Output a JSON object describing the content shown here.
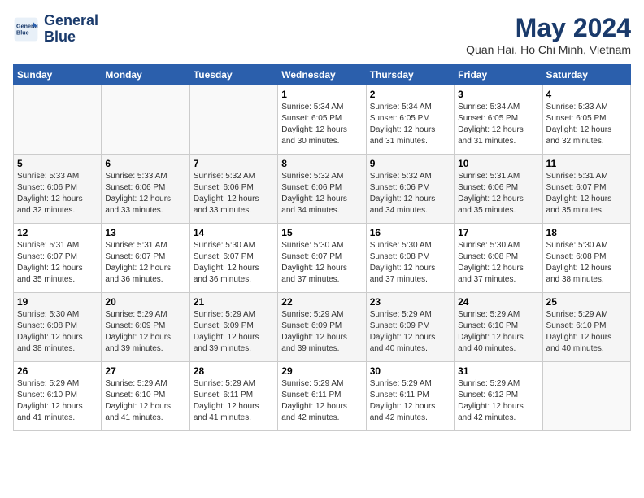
{
  "header": {
    "logo_line1": "General",
    "logo_line2": "Blue",
    "month_title": "May 2024",
    "location": "Quan Hai, Ho Chi Minh, Vietnam"
  },
  "weekdays": [
    "Sunday",
    "Monday",
    "Tuesday",
    "Wednesday",
    "Thursday",
    "Friday",
    "Saturday"
  ],
  "weeks": [
    [
      {
        "day": "",
        "info": ""
      },
      {
        "day": "",
        "info": ""
      },
      {
        "day": "",
        "info": ""
      },
      {
        "day": "1",
        "info": "Sunrise: 5:34 AM\nSunset: 6:05 PM\nDaylight: 12 hours\nand 30 minutes."
      },
      {
        "day": "2",
        "info": "Sunrise: 5:34 AM\nSunset: 6:05 PM\nDaylight: 12 hours\nand 31 minutes."
      },
      {
        "day": "3",
        "info": "Sunrise: 5:34 AM\nSunset: 6:05 PM\nDaylight: 12 hours\nand 31 minutes."
      },
      {
        "day": "4",
        "info": "Sunrise: 5:33 AM\nSunset: 6:05 PM\nDaylight: 12 hours\nand 32 minutes."
      }
    ],
    [
      {
        "day": "5",
        "info": "Sunrise: 5:33 AM\nSunset: 6:06 PM\nDaylight: 12 hours\nand 32 minutes."
      },
      {
        "day": "6",
        "info": "Sunrise: 5:33 AM\nSunset: 6:06 PM\nDaylight: 12 hours\nand 33 minutes."
      },
      {
        "day": "7",
        "info": "Sunrise: 5:32 AM\nSunset: 6:06 PM\nDaylight: 12 hours\nand 33 minutes."
      },
      {
        "day": "8",
        "info": "Sunrise: 5:32 AM\nSunset: 6:06 PM\nDaylight: 12 hours\nand 34 minutes."
      },
      {
        "day": "9",
        "info": "Sunrise: 5:32 AM\nSunset: 6:06 PM\nDaylight: 12 hours\nand 34 minutes."
      },
      {
        "day": "10",
        "info": "Sunrise: 5:31 AM\nSunset: 6:06 PM\nDaylight: 12 hours\nand 35 minutes."
      },
      {
        "day": "11",
        "info": "Sunrise: 5:31 AM\nSunset: 6:07 PM\nDaylight: 12 hours\nand 35 minutes."
      }
    ],
    [
      {
        "day": "12",
        "info": "Sunrise: 5:31 AM\nSunset: 6:07 PM\nDaylight: 12 hours\nand 35 minutes."
      },
      {
        "day": "13",
        "info": "Sunrise: 5:31 AM\nSunset: 6:07 PM\nDaylight: 12 hours\nand 36 minutes."
      },
      {
        "day": "14",
        "info": "Sunrise: 5:30 AM\nSunset: 6:07 PM\nDaylight: 12 hours\nand 36 minutes."
      },
      {
        "day": "15",
        "info": "Sunrise: 5:30 AM\nSunset: 6:07 PM\nDaylight: 12 hours\nand 37 minutes."
      },
      {
        "day": "16",
        "info": "Sunrise: 5:30 AM\nSunset: 6:08 PM\nDaylight: 12 hours\nand 37 minutes."
      },
      {
        "day": "17",
        "info": "Sunrise: 5:30 AM\nSunset: 6:08 PM\nDaylight: 12 hours\nand 37 minutes."
      },
      {
        "day": "18",
        "info": "Sunrise: 5:30 AM\nSunset: 6:08 PM\nDaylight: 12 hours\nand 38 minutes."
      }
    ],
    [
      {
        "day": "19",
        "info": "Sunrise: 5:30 AM\nSunset: 6:08 PM\nDaylight: 12 hours\nand 38 minutes."
      },
      {
        "day": "20",
        "info": "Sunrise: 5:29 AM\nSunset: 6:09 PM\nDaylight: 12 hours\nand 39 minutes."
      },
      {
        "day": "21",
        "info": "Sunrise: 5:29 AM\nSunset: 6:09 PM\nDaylight: 12 hours\nand 39 minutes."
      },
      {
        "day": "22",
        "info": "Sunrise: 5:29 AM\nSunset: 6:09 PM\nDaylight: 12 hours\nand 39 minutes."
      },
      {
        "day": "23",
        "info": "Sunrise: 5:29 AM\nSunset: 6:09 PM\nDaylight: 12 hours\nand 40 minutes."
      },
      {
        "day": "24",
        "info": "Sunrise: 5:29 AM\nSunset: 6:10 PM\nDaylight: 12 hours\nand 40 minutes."
      },
      {
        "day": "25",
        "info": "Sunrise: 5:29 AM\nSunset: 6:10 PM\nDaylight: 12 hours\nand 40 minutes."
      }
    ],
    [
      {
        "day": "26",
        "info": "Sunrise: 5:29 AM\nSunset: 6:10 PM\nDaylight: 12 hours\nand 41 minutes."
      },
      {
        "day": "27",
        "info": "Sunrise: 5:29 AM\nSunset: 6:10 PM\nDaylight: 12 hours\nand 41 minutes."
      },
      {
        "day": "28",
        "info": "Sunrise: 5:29 AM\nSunset: 6:11 PM\nDaylight: 12 hours\nand 41 minutes."
      },
      {
        "day": "29",
        "info": "Sunrise: 5:29 AM\nSunset: 6:11 PM\nDaylight: 12 hours\nand 42 minutes."
      },
      {
        "day": "30",
        "info": "Sunrise: 5:29 AM\nSunset: 6:11 PM\nDaylight: 12 hours\nand 42 minutes."
      },
      {
        "day": "31",
        "info": "Sunrise: 5:29 AM\nSunset: 6:12 PM\nDaylight: 12 hours\nand 42 minutes."
      },
      {
        "day": "",
        "info": ""
      }
    ]
  ]
}
